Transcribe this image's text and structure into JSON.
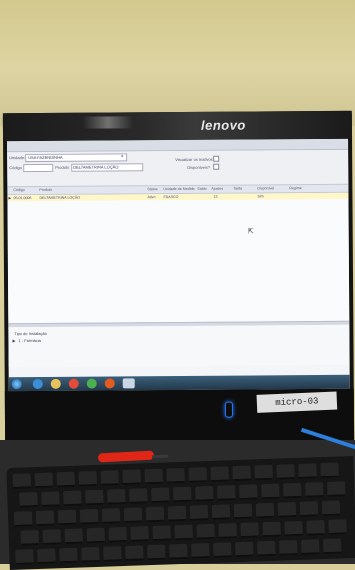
{
  "monitor": {
    "brand": "lenovo",
    "sticker": "micro-03"
  },
  "app": {
    "filters": {
      "unidade_label": "Unidade:",
      "unidade_value": "USA FAZENDINHA",
      "codigo_label": "Código",
      "produto_label": "Produto",
      "produto_value": "DELTAMETRINA LOÇÃO",
      "check1_label": "Visualizar os Inativos?",
      "check2_label": "Disponíveis?"
    },
    "grid": {
      "headers": [
        "Código",
        "Produto",
        "Status",
        "Unidade de Medida",
        "Saldo",
        "Ajustes",
        "Tarifa",
        "Disponível",
        "Regime"
      ],
      "rows": [
        [
          "05.01.0006",
          "DELTAMETRINA LOÇÃO",
          "Ativo",
          "FRASCO",
          "",
          "13",
          "",
          "Sim",
          ""
        ]
      ]
    },
    "bottom": {
      "tipo_label": "Tipo de Instalação",
      "tree_item": "1 - Farmácia"
    }
  }
}
